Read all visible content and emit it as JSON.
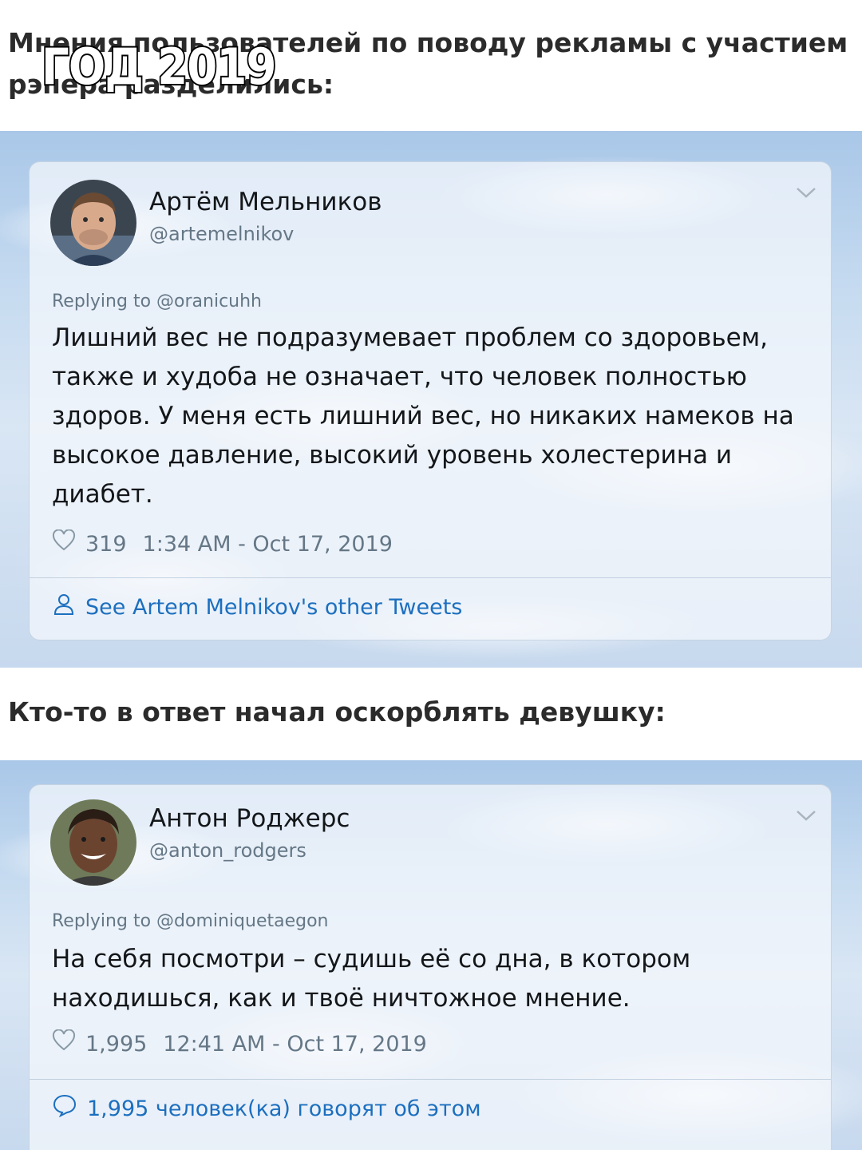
{
  "meme_label": "ГОД 2019",
  "heading1": "Мнения пользователей по поводу рекламы с участием рэпера разделились:",
  "heading2": "Кто-то в ответ начал оскорблять девушку:",
  "tweets": [
    {
      "name": "Артём Мельников",
      "handle": "@artemelnikov",
      "replying_to": "Replying to @oranicuhh",
      "text": "Лишний вес не подразумевает проблем со здоровьем, также и худоба не означает, что человек полностью здоров. У меня есть лишний вес, но никаких намеков на высокое давление, высокий уровень холестерина и диабет.",
      "likes": "319",
      "timestamp": "1:34 AM - Oct 17, 2019",
      "footer": "See Artem Melnikov's other Tweets",
      "footer_icon": "person-icon"
    },
    {
      "name": "Антон Роджерс",
      "handle": "@anton_rodgers",
      "replying_to": "Replying to @dominiquetaegon",
      "text": "На себя посмотри – судишь её со дна, в котором находишься, как и твоё ничтожное мнение.",
      "likes": "1,995",
      "timestamp": "12:41 AM - Oct 17, 2019",
      "footer": "1,995 человек(ка) говорят об этом",
      "footer_icon": "comment-icon"
    }
  ],
  "colors": {
    "link": "#1c6fbf",
    "muted": "#657786",
    "text": "#14171a"
  }
}
